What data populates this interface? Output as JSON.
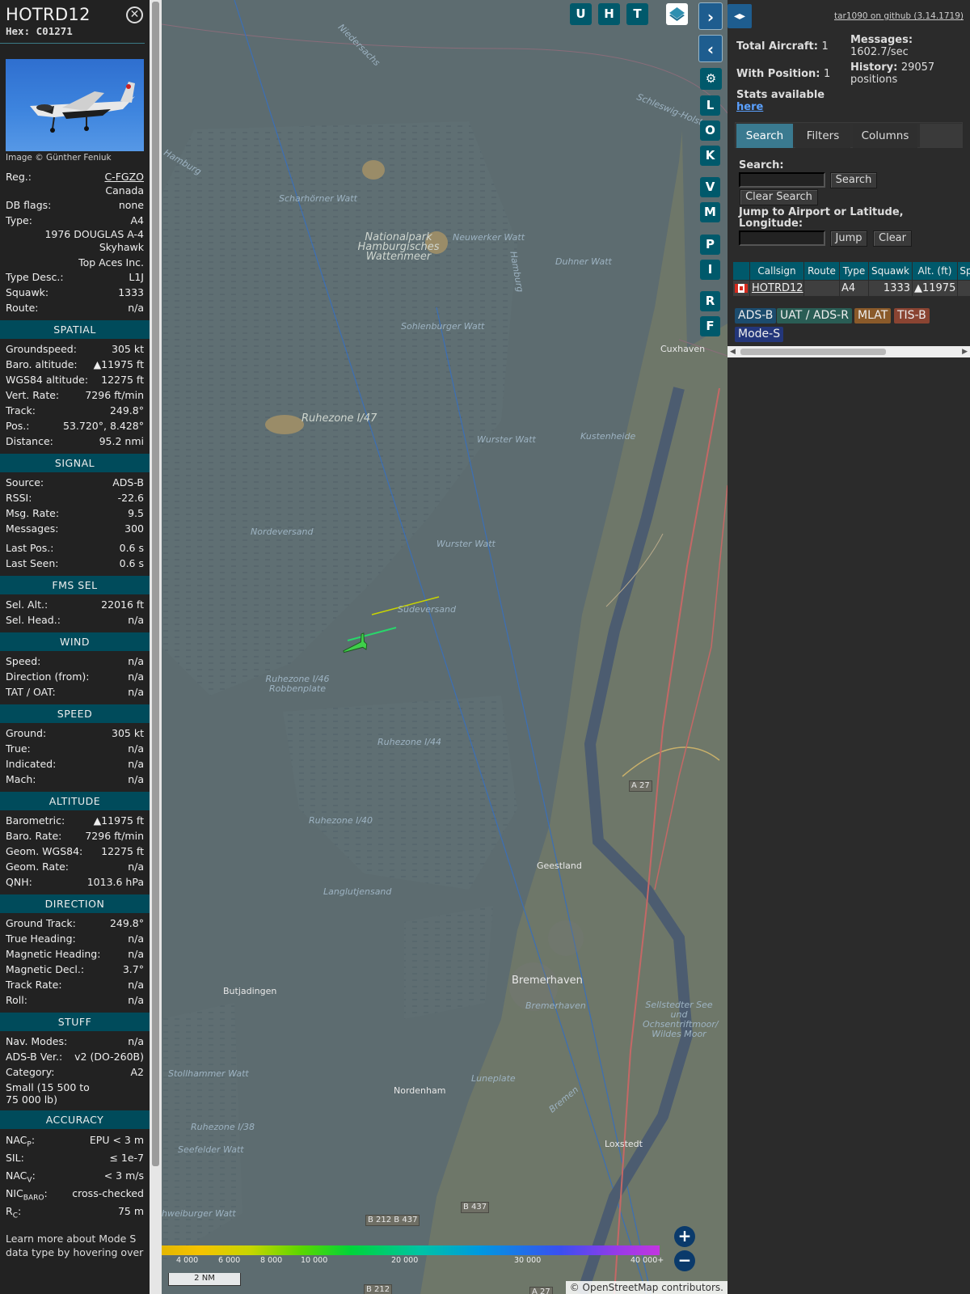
{
  "info": {
    "callsign": "HOTRD12",
    "hex_label": "Hex:",
    "hex": "C01271",
    "photo_credit": "Image © Günther Feniuk",
    "registration": {
      "label": "Reg.:",
      "value": "C-FGZO",
      "country": "Canada"
    },
    "db_flags": {
      "label": "DB flags:",
      "value": "none"
    },
    "type": {
      "label": "Type:",
      "value": "A4",
      "full_line1": "1976 DOUGLAS A-4",
      "full_line2": "Skyhawk",
      "operator": "Top Aces Inc."
    },
    "type_desc": {
      "label": "Type Desc.:",
      "value": "L1J"
    },
    "squawk": {
      "label": "Squawk:",
      "value": "1333"
    },
    "route": {
      "label": "Route:",
      "value": "n/a"
    },
    "sections": [
      {
        "title": "SPATIAL",
        "rows": [
          {
            "k": "Groundspeed:",
            "v": "305 kt"
          },
          {
            "k": "Baro. altitude:",
            "v": "▲11975 ft"
          },
          {
            "k": "WGS84 altitude:",
            "v": "12275 ft"
          },
          {
            "k": "Vert. Rate:",
            "v": "7296 ft/min"
          },
          {
            "k": "Track:",
            "v": "249.8°"
          },
          {
            "k": "Pos.:",
            "v": "53.720°, 8.428°"
          },
          {
            "k": "Distance:",
            "v": "95.2 nmi"
          }
        ]
      },
      {
        "title": "SIGNAL",
        "rows": [
          {
            "k": "Source:",
            "v": "ADS-B"
          },
          {
            "k": "RSSI:",
            "v": "-22.6"
          },
          {
            "k": "Msg. Rate:",
            "v": "9.5"
          },
          {
            "k": "Messages:",
            "v": "300"
          },
          {
            "k": "Last Pos.:",
            "v": "0.6 s"
          },
          {
            "k": "Last Seen:",
            "v": "0.6 s"
          }
        ]
      },
      {
        "title": "FMS SEL",
        "rows": [
          {
            "k": "Sel. Alt.:",
            "v": "22016 ft"
          },
          {
            "k": "Sel. Head.:",
            "v": "n/a"
          }
        ]
      },
      {
        "title": "WIND",
        "rows": [
          {
            "k": "Speed:",
            "v": "n/a"
          },
          {
            "k": "Direction (from):",
            "v": "n/a"
          },
          {
            "k": "TAT / OAT:",
            "v": "n/a"
          }
        ]
      },
      {
        "title": "SPEED",
        "rows": [
          {
            "k": "Ground:",
            "v": "305 kt"
          },
          {
            "k": "True:",
            "v": "n/a"
          },
          {
            "k": "Indicated:",
            "v": "n/a"
          },
          {
            "k": "Mach:",
            "v": "n/a"
          }
        ]
      },
      {
        "title": "ALTITUDE",
        "rows": [
          {
            "k": "Barometric:",
            "v": "▲11975 ft"
          },
          {
            "k": "Baro. Rate:",
            "v": "7296 ft/min"
          },
          {
            "k": "Geom. WGS84:",
            "v": "12275 ft"
          },
          {
            "k": "Geom. Rate:",
            "v": "n/a"
          },
          {
            "k": "QNH:",
            "v": "1013.6 hPa"
          }
        ]
      },
      {
        "title": "DIRECTION",
        "rows": [
          {
            "k": "Ground Track:",
            "v": "249.8°"
          },
          {
            "k": "True Heading:",
            "v": "n/a"
          },
          {
            "k": "Magnetic Heading:",
            "v": "n/a"
          },
          {
            "k": "Magnetic Decl.:",
            "v": "3.7°"
          },
          {
            "k": "Track Rate:",
            "v": "n/a"
          },
          {
            "k": "Roll:",
            "v": "n/a"
          }
        ]
      },
      {
        "title": "STUFF",
        "rows": [
          {
            "k": "Nav. Modes:",
            "v": "n/a"
          },
          {
            "k": "ADS-B Ver.:",
            "v": "v2 (DO-260B)"
          },
          {
            "k": "Category:",
            "v": "A2"
          }
        ],
        "extra": "Small (15 500 to 75 000 lb)"
      },
      {
        "title": "ACCURACY",
        "rows": [
          {
            "k": "NACP:",
            "v": "EPU < 3 m"
          },
          {
            "k": "SIL:",
            "v": "≤ 1e-7"
          },
          {
            "k": "NACV:",
            "v": "< 3 m/s"
          },
          {
            "k": "NICBARO:",
            "v": "cross-checked"
          },
          {
            "k": "RC:",
            "v": "75 m"
          }
        ]
      }
    ],
    "learn_more": "Learn more about Mode S data type by hovering over"
  },
  "map": {
    "toolbar_letters": [
      "U",
      "H",
      "T"
    ],
    "side_letters": [
      "L",
      "O",
      "K",
      "V",
      "M",
      "P",
      "I",
      "R",
      "F"
    ],
    "labels": [
      {
        "text": "Niedersachs",
        "cls": ""
      },
      {
        "text": "Schleswig-Holst",
        "cls": ""
      },
      {
        "text": "Scharhörner Watt",
        "cls": ""
      },
      {
        "text": "Neuwerker Watt",
        "cls": ""
      },
      {
        "text": "Nationalpark Hamburgisches Wattenmeer",
        "cls": "big"
      },
      {
        "text": "Duhner Watt",
        "cls": ""
      },
      {
        "text": "Hamburg",
        "cls": ""
      },
      {
        "text": "Sohlenburger Watt",
        "cls": ""
      },
      {
        "text": "Cuxhaven",
        "cls": "town"
      },
      {
        "text": "Ruhezone I/47",
        "cls": "big"
      },
      {
        "text": "Wurster Watt",
        "cls": ""
      },
      {
        "text": "Kustenheide",
        "cls": ""
      },
      {
        "text": "Nordeversand",
        "cls": ""
      },
      {
        "text": "Wurster Watt",
        "cls": ""
      },
      {
        "text": "Südeversand",
        "cls": ""
      },
      {
        "text": "Ruhezone I/46 Robbenplate",
        "cls": ""
      },
      {
        "text": "Ruhezone I/44",
        "cls": ""
      },
      {
        "text": "Ruhezone I/40",
        "cls": ""
      },
      {
        "text": "Langlutjensand",
        "cls": ""
      },
      {
        "text": "Geestland",
        "cls": "town"
      },
      {
        "text": "Butjadingen",
        "cls": "town"
      },
      {
        "text": "Bremerhaven",
        "cls": "town big2"
      },
      {
        "text": "Bremerhaven",
        "cls": ""
      },
      {
        "text": "Sellstedter See und Ochsentriftmoor/ Wildes Moor",
        "cls": ""
      },
      {
        "text": "Stollhammer Watt",
        "cls": ""
      },
      {
        "text": "Nordenham",
        "cls": "town"
      },
      {
        "text": "Luneplate",
        "cls": ""
      },
      {
        "text": "Bremen",
        "cls": ""
      },
      {
        "text": "Loxstedt",
        "cls": "town"
      },
      {
        "text": "Ruhezone I/38",
        "cls": ""
      },
      {
        "text": "Seefelder Watt",
        "cls": ""
      },
      {
        "text": "hweiburger Watt",
        "cls": ""
      },
      {
        "text": "A 27",
        "cls": "road"
      },
      {
        "text": "B 437",
        "cls": "road"
      },
      {
        "text": "B 212 B 437",
        "cls": "road"
      },
      {
        "text": "B 212",
        "cls": "road"
      },
      {
        "text": "A 27",
        "cls": "road"
      },
      {
        "text": "Hamburg",
        "cls": ""
      }
    ],
    "legend_ticks": [
      "4 000",
      "6 000",
      "8 000",
      "10 000",
      "20 000",
      "30 000",
      "40 000+"
    ],
    "scale_label": "2 NM",
    "attribution": "© OpenStreetMap contributors.",
    "zoom_in": "+",
    "zoom_out": "−"
  },
  "right": {
    "toggle_icon": "◂▸",
    "github": "tar1090 on github (3.14.1719)",
    "total_aircraft_label": "Total Aircraft:",
    "total_aircraft": "1",
    "with_position_label": "With Position:",
    "with_position": "1",
    "messages_label": "Messages:",
    "messages": "1602.7/sec",
    "history_label": "History:",
    "history": "29057 positions",
    "stats_label": "Stats available",
    "stats_link": "here",
    "tabs": [
      "Search",
      "Filters",
      "Columns"
    ],
    "search_label": "Search:",
    "search_button": "Search",
    "clear_search_button": "Clear Search",
    "jump_label": "Jump to Airport or Latitude, Longitude:",
    "jump_button": "Jump",
    "clear_button": "Clear",
    "table_headers": [
      "",
      "Callsign",
      "Route",
      "Type",
      "Squawk",
      "Alt. (ft)",
      "Sp"
    ],
    "table_rows": [
      {
        "callsign": "HOTRD12",
        "route": "",
        "type": "A4",
        "squawk": "1333",
        "alt": "▲11975",
        "sp": ""
      }
    ],
    "source_pills": [
      {
        "text": "ADS-B",
        "color": "#1c4c6e"
      },
      {
        "text": "UAT / ADS-R",
        "color": "#2a5d55"
      },
      {
        "text": "MLAT",
        "color": "#8a5a2a"
      },
      {
        "text": "TIS-B",
        "color": "#8a4432"
      },
      {
        "text": "Mode-S",
        "color": "#23367a"
      }
    ]
  }
}
